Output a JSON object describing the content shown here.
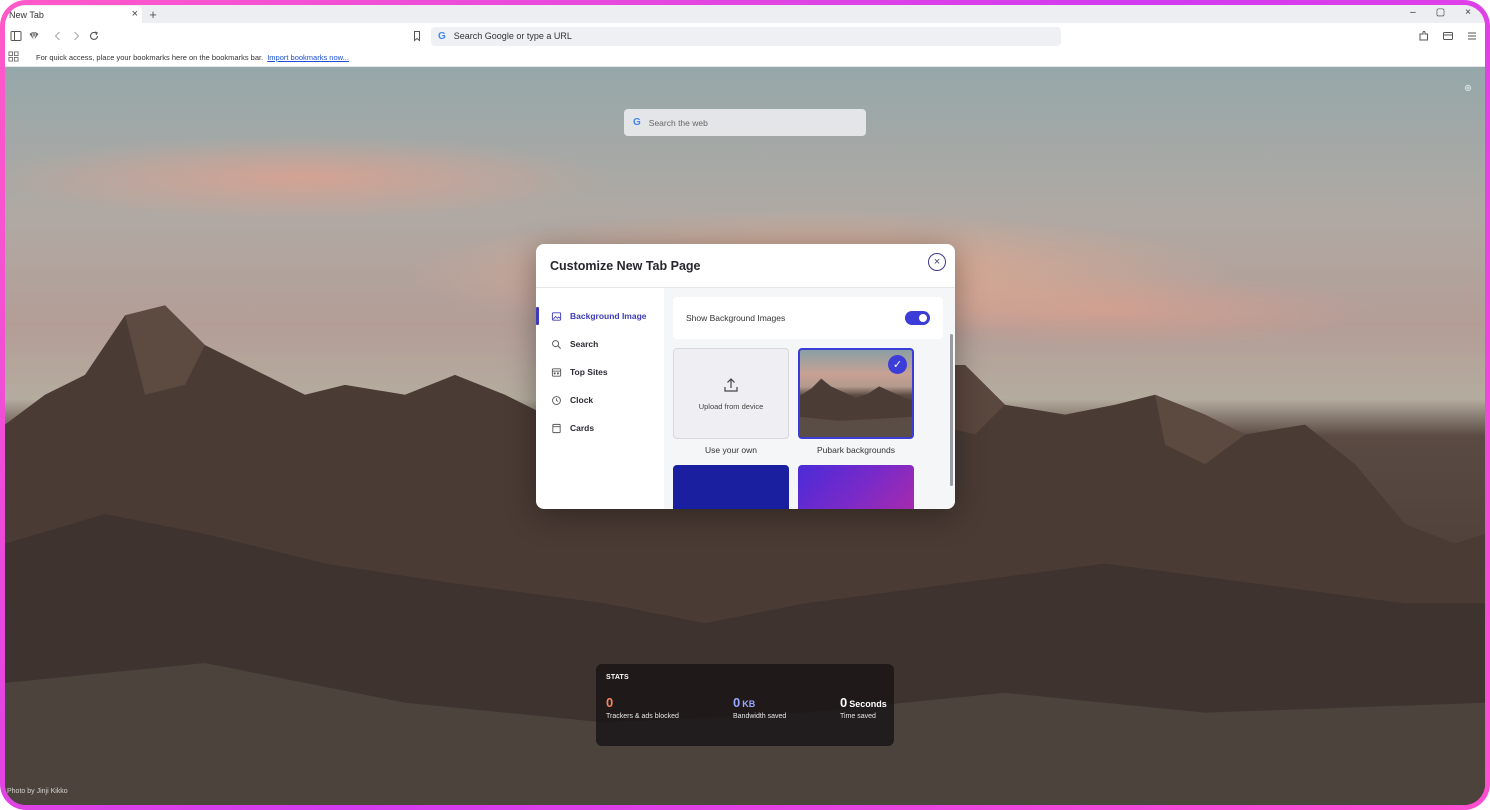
{
  "browser": {
    "tab_title": "New Tab",
    "tab_close": "×",
    "new_tab": "+",
    "window_controls": [
      "–",
      "▢",
      "×"
    ],
    "omnibox_placeholder": "Search Google or type a URL",
    "google_glyph": "G"
  },
  "bookmarks_bar": {
    "message": "For quick access, place your bookmarks here on the bookmarks bar.",
    "import_link": "Import bookmarks now..."
  },
  "ntp": {
    "search_placeholder": "Search the web",
    "photo_credit": "Photo by Jinji Kikko"
  },
  "stats": {
    "title": "STATS",
    "items": [
      {
        "value": "0",
        "unit": "",
        "label": "Trackers & ads blocked",
        "color": "#f4885c"
      },
      {
        "value": "0",
        "unit": "KB",
        "label": "Bandwidth saved",
        "color": "#9aa6ff"
      },
      {
        "value": "0",
        "unit": "Seconds",
        "label": "Time saved",
        "color": "#ffffff"
      }
    ]
  },
  "modal": {
    "title": "Customize New Tab Page",
    "close": "×",
    "sidebar": [
      {
        "label": "Background Image",
        "icon": "image-icon",
        "active": true
      },
      {
        "label": "Search",
        "icon": "search-icon",
        "active": false
      },
      {
        "label": "Top Sites",
        "icon": "top-sites-icon",
        "active": false
      },
      {
        "label": "Clock",
        "icon": "clock-icon",
        "active": false
      },
      {
        "label": "Cards",
        "icon": "cards-icon",
        "active": false
      }
    ],
    "toggle_label": "Show Background Images",
    "toggle_on": true,
    "upload_text": "Upload from device",
    "tiles": [
      {
        "caption": "Use your own"
      },
      {
        "caption": "Pubark backgrounds",
        "selected": true
      }
    ],
    "check_glyph": "✓"
  },
  "colors": {
    "accent": "#3c3cd8",
    "frame": "#e040e8"
  }
}
